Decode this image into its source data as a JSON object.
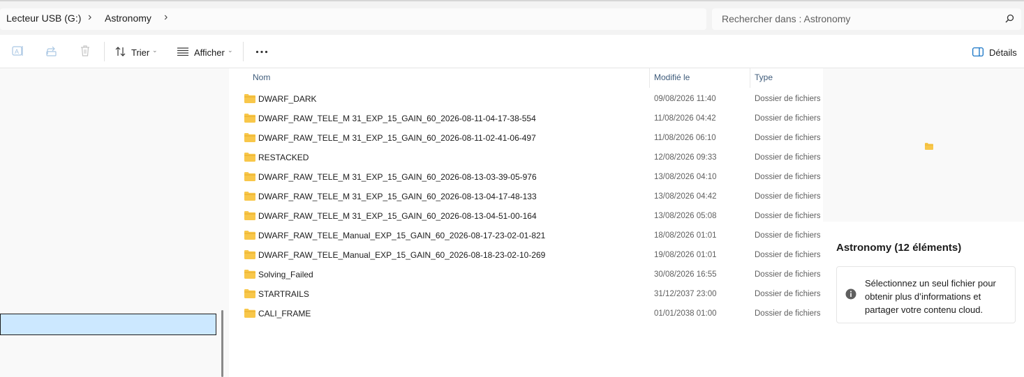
{
  "address": {
    "crumbs": [
      "Lecteur USB (G:)",
      "Astronomy"
    ],
    "search_placeholder": "Rechercher dans : Astronomy"
  },
  "toolbar": {
    "sort_label": "Trier",
    "view_label": "Afficher",
    "details_label": "Détails"
  },
  "columns": {
    "name": "Nom",
    "modified": "Modifié le",
    "type": "Type"
  },
  "files": [
    {
      "name": "DWARF_DARK",
      "date": "09/08/2026 11:40",
      "type": "Dossier de fichiers"
    },
    {
      "name": "DWARF_RAW_TELE_M 31_EXP_15_GAIN_60_2026-08-11-04-17-38-554",
      "date": "11/08/2026 04:42",
      "type": "Dossier de fichiers"
    },
    {
      "name": "DWARF_RAW_TELE_M 31_EXP_15_GAIN_60_2026-08-11-02-41-06-497",
      "date": "11/08/2026 06:10",
      "type": "Dossier de fichiers"
    },
    {
      "name": "RESTACKED",
      "date": "12/08/2026 09:33",
      "type": "Dossier de fichiers"
    },
    {
      "name": "DWARF_RAW_TELE_M 31_EXP_15_GAIN_60_2026-08-13-03-39-05-976",
      "date": "13/08/2026 04:10",
      "type": "Dossier de fichiers"
    },
    {
      "name": "DWARF_RAW_TELE_M 31_EXP_15_GAIN_60_2026-08-13-04-17-48-133",
      "date": "13/08/2026 04:42",
      "type": "Dossier de fichiers"
    },
    {
      "name": "DWARF_RAW_TELE_M 31_EXP_15_GAIN_60_2026-08-13-04-51-00-164",
      "date": "13/08/2026 05:08",
      "type": "Dossier de fichiers"
    },
    {
      "name": "DWARF_RAW_TELE_Manual_EXP_15_GAIN_60_2026-08-17-23-02-01-821",
      "date": "18/08/2026 01:01",
      "type": "Dossier de fichiers"
    },
    {
      "name": "DWARF_RAW_TELE_Manual_EXP_15_GAIN_60_2026-08-18-23-02-10-269",
      "date": "19/08/2026 01:01",
      "type": "Dossier de fichiers"
    },
    {
      "name": "Solving_Failed",
      "date": "30/08/2026 16:55",
      "type": "Dossier de fichiers"
    },
    {
      "name": "STARTRAILS",
      "date": "31/12/2037 23:00",
      "type": "Dossier de fichiers"
    },
    {
      "name": "CALI_FRAME",
      "date": "01/01/2038 01:00",
      "type": "Dossier de fichiers"
    }
  ],
  "details": {
    "title": "Astronomy (12 éléments)",
    "message": "Sélectionnez un seul fichier pour obtenir plus d’informations et partager votre contenu cloud."
  },
  "colors": {
    "folder": "#f8c74a",
    "selection": "#cce8ff",
    "accent": "#0067c0"
  },
  "icons": {
    "folder": "folder-icon",
    "search": "search-icon",
    "info": "info-icon"
  }
}
